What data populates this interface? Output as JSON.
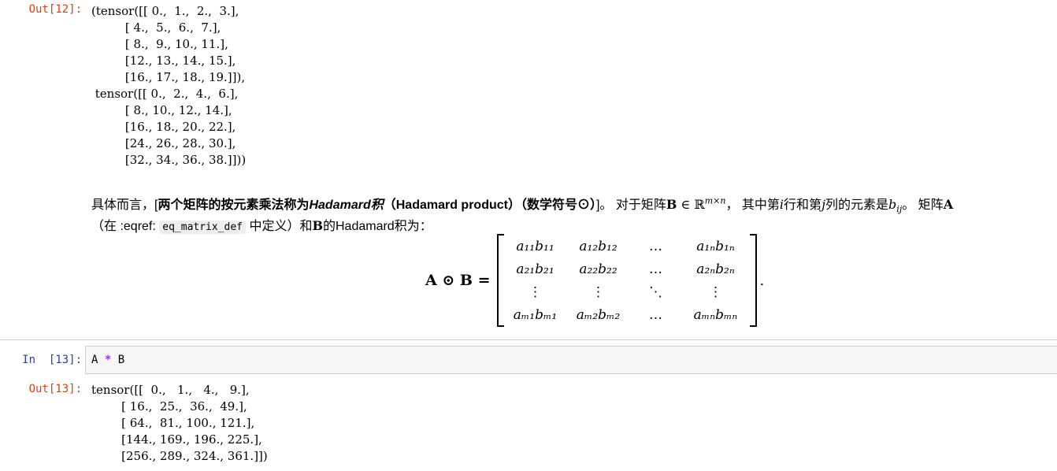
{
  "cells": {
    "out12": {
      "prompt": "Out[12]:",
      "text": "(tensor([[ 0.,  1.,  2.,  3.],\n         [ 4.,  5.,  6.,  7.],\n         [ 8.,  9., 10., 11.],\n         [12., 13., 14., 15.],\n         [16., 17., 18., 19.]]),\n tensor([[ 0.,  2.,  4.,  6.],\n         [ 8., 10., 12., 14.],\n         [16., 18., 20., 22.],\n         [24., 26., 28., 30.],\n         [32., 34., 36., 38.]]))"
    },
    "markdown": {
      "lead": "具体而言，[",
      "bold_a": "两个矩阵的按元素乘法称为",
      "bold_italic": "Hadamard积",
      "bold_b": "（Hadamard product）（数学符号⊙）",
      "after_bold": "]。 对于矩阵",
      "mat_b": "B",
      "in_r": " ∈ ℝ",
      "sup": "m×n",
      "mid_text": "， 其中第",
      "var_i": "i",
      "row_text": "行和第",
      "var_j": "j",
      "col_text": "列的元素是",
      "var_b": "b",
      "sub_ij": "ij",
      "tail_text": "。 矩阵",
      "mat_a": "A",
      "line2_pre": "（在 :eqref: ",
      "code": "eq_matrix_def",
      "line2_mid": " 中定义）和",
      "mat_b2": "B",
      "line2_post": "的Hadamard积为："
    },
    "equation": {
      "lhs": "A ⊙ B =",
      "rows": [
        [
          "a₁₁b₁₁",
          "a₁₂b₁₂",
          "…",
          "a₁ₙb₁ₙ"
        ],
        [
          "a₂₁b₂₁",
          "a₂₂b₂₂",
          "…",
          "a₂ₙb₂ₙ"
        ],
        [
          "⋮",
          "⋮",
          "⋱",
          "⋮"
        ],
        [
          "aₘ₁bₘ₁",
          "aₘ₂bₘ₂",
          "…",
          "aₘₙbₘₙ"
        ]
      ],
      "period": "."
    },
    "in13": {
      "prompt": "In  [13]:",
      "code_a": "A",
      "operator": "*",
      "code_b": "B"
    },
    "out13": {
      "prompt": "Out[13]:",
      "text": "tensor([[  0.,   1.,   4.,   9.],\n        [ 16.,  25.,  36.,  49.],\n        [ 64.,  81., 100., 121.],\n        [144., 169., 196., 225.],\n        [256., 289., 324., 361.]])"
    }
  },
  "colors": {
    "out_prompt": "#d84315",
    "in_prompt": "#303f9f",
    "operator": "#aa22ff",
    "input_bg": "#f7f7f7"
  }
}
